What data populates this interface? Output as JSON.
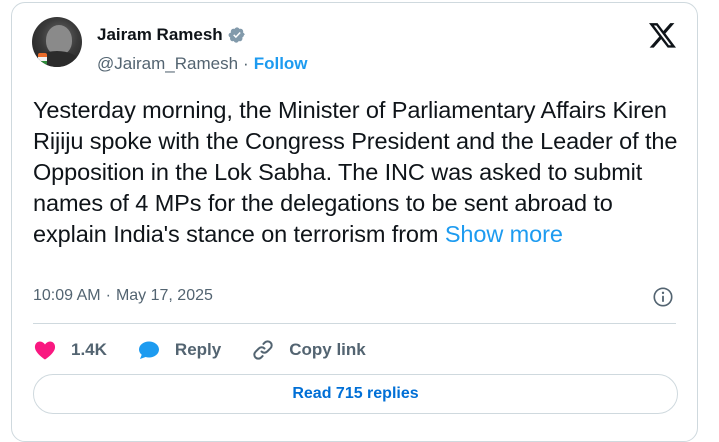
{
  "author": {
    "name": "Jairam Ramesh",
    "handle": "@Jairam_Ramesh",
    "separator": "·",
    "follow_label": "Follow",
    "verified_icon": "verified-badge-icon",
    "verified_color": "#829aab"
  },
  "brand": {
    "logo_icon": "x-logo-icon"
  },
  "tweet": {
    "text": "Yesterday morning, the Minister of Parliamentary Affairs Kiren Rijiju spoke with the Congress President and the Leader of the Opposition in the Lok Sabha. The INC was asked to submit names of 4 MPs for the delegations to be sent abroad to explain India's stance on terrorism from",
    "show_more_label": "Show more",
    "link_color": "#1d9bf0"
  },
  "meta": {
    "time": "10:09 AM",
    "separator": "·",
    "date": "May 17, 2025",
    "info_icon": "info-icon"
  },
  "actions": {
    "like_count": "1.4K",
    "like_color": "#f91880",
    "reply_label": "Reply",
    "reply_color": "#1d9bf0",
    "copy_link_label": "Copy link"
  },
  "replies": {
    "label": "Read 715 replies",
    "color": "#006fd6"
  }
}
